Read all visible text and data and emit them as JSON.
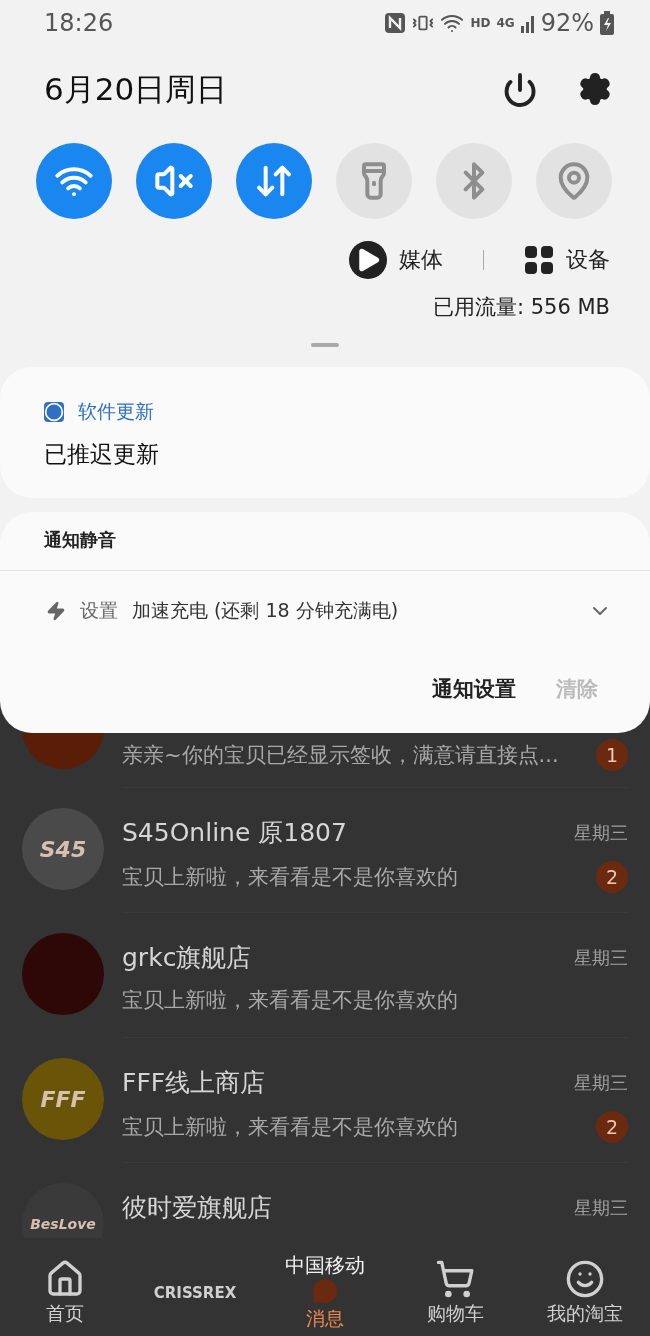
{
  "status_bar": {
    "time": "18:26",
    "network_label": "HD",
    "network_type": "4G",
    "battery": "92%"
  },
  "header": {
    "date": "6月20日周日"
  },
  "quick_toggles": [
    {
      "kind": "wifi",
      "on": true
    },
    {
      "kind": "mute",
      "on": true
    },
    {
      "kind": "data",
      "on": true
    },
    {
      "kind": "flashlight",
      "on": false
    },
    {
      "kind": "bluetooth",
      "on": false
    },
    {
      "kind": "location",
      "on": false
    }
  ],
  "media_row": {
    "media": "媒体",
    "devices": "设备"
  },
  "data_usage": "已用流量: 556 MB",
  "notifications": [
    {
      "app": "软件更新",
      "text": "已推迟更新"
    }
  ],
  "silent_section": {
    "title": "通知静音",
    "items": [
      {
        "app": "设置",
        "text": "加速充电 (还剩 18 分钟充满电)",
        "expanded": false
      }
    ]
  },
  "actions": [
    {
      "label": "通知设置",
      "disabled": false
    },
    {
      "label": "清除",
      "disabled": true
    }
  ],
  "background_app": {
    "rows": [
      {
        "subtitle": "亲亲~你的宝贝已经显示签收，满意请直接点...",
        "badge": "1",
        "kind": "seal"
      },
      {
        "title": "S45Online 原1807",
        "time": "星期三",
        "subtitle": "宝贝上新啦，来看看是不是你喜欢的",
        "badge": "2",
        "kind": "lettered",
        "logo_text": "S45"
      },
      {
        "title": "grkc旗舰店",
        "time": "星期三",
        "subtitle": "宝贝上新啦，来看看是不是你喜欢的",
        "kind": "ring"
      },
      {
        "title": "FFF线上商店",
        "time": "星期三",
        "subtitle": "宝贝上新啦，来看看是不是你喜欢的",
        "badge": "2",
        "kind": "emblem",
        "logo_text": "FFF"
      },
      {
        "title": "彼时爱旗舰店",
        "time": "星期三",
        "kind": "wordmark",
        "logo_text": "BesLove"
      }
    ],
    "nav": [
      {
        "kind": "home",
        "label": "首页",
        "selected": false
      },
      {
        "kind": "logo",
        "logo_text": "CRISSREX",
        "selected": false
      },
      {
        "kind": "messages",
        "label": "消息",
        "selected": true
      },
      {
        "kind": "cart",
        "label": "购物车",
        "selected": false
      },
      {
        "kind": "profile",
        "label": "我的淘宝",
        "selected": false
      }
    ],
    "carrier": "中国移动"
  }
}
